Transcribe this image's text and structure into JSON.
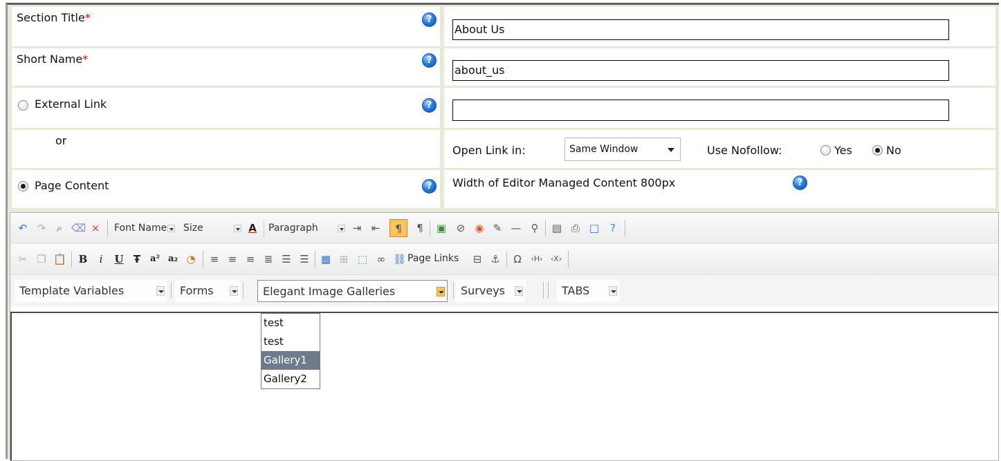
{
  "form": {
    "section_title": {
      "label": "Section Title",
      "required": "*",
      "value": "About Us"
    },
    "short_name": {
      "label": "Short Name",
      "required": "*",
      "value": "about_us"
    },
    "external_link": {
      "label": "External Link",
      "value": ""
    },
    "or_label": "or",
    "open_link": {
      "label": "Open Link in:",
      "value": "Same Window"
    },
    "nofollow": {
      "label": "Use Nofollow:",
      "yes": "Yes",
      "no": "No",
      "selected": "No"
    },
    "page_content": {
      "label": "Page Content",
      "selected": true
    },
    "editor_width_note": "Width of Editor Managed Content 800px",
    "help_glyph": "?"
  },
  "editor": {
    "toolbar1": {
      "icons": [
        "undo-icon",
        "redo-icon",
        "find-icon",
        "eraser-icon",
        "delete-icon",
        "text-color-icon",
        "indent-icon",
        "outdent-icon",
        "ltr-icon",
        "rtl-icon",
        "image-icon",
        "flash-icon",
        "media-icon",
        "edit-icon",
        "hr-icon",
        "zoom-icon",
        "save-icon",
        "print-icon",
        "fullscreen-icon",
        "help-icon"
      ],
      "font_name": "Font Name",
      "size": "Size",
      "paragraph": "Paragraph"
    },
    "toolbar2": {
      "icons": [
        "cut-icon",
        "copy-icon",
        "paste-icon",
        "bold-icon",
        "italic-icon",
        "underline-icon",
        "strike-icon",
        "superscript-icon",
        "subscript-icon",
        "format-stripper-icon",
        "align-left-icon",
        "align-center-icon",
        "align-right-icon",
        "justify-icon",
        "ordered-list-icon",
        "unordered-list-icon",
        "table-icon",
        "table-props-icon",
        "table-wizard-icon",
        "link-icon",
        "page-link-icon",
        "form-icon",
        "anchor-icon",
        "special-char-icon",
        "html-tag-icon",
        "xml-tag-icon"
      ],
      "glyphs": {
        "italic": "i",
        "subscript": "a₂",
        "superscript": "a²",
        "bold": "B",
        "underline": "U",
        "strike": "Ŧ",
        "special_char": "Ω",
        "html_tag": "‹H›",
        "xml_tag": "‹X›",
        "delete": "×"
      },
      "page_links": "Page Links"
    },
    "toolbar3": {
      "template_variables": "Template Variables",
      "forms": "Forms",
      "galleries": "Elegant Image Galleries",
      "surveys": "Surveys",
      "tabs": "TABS"
    },
    "gallery_dropdown": {
      "items": [
        "test",
        "test",
        "Gallery1",
        "Gallery2"
      ],
      "highlighted": "Gallery1"
    }
  },
  "colors": {
    "required": "#d00000",
    "grid": "#e6ead7",
    "highlight": "#6e7b8b",
    "active_dropdown": "#f9c55c"
  }
}
